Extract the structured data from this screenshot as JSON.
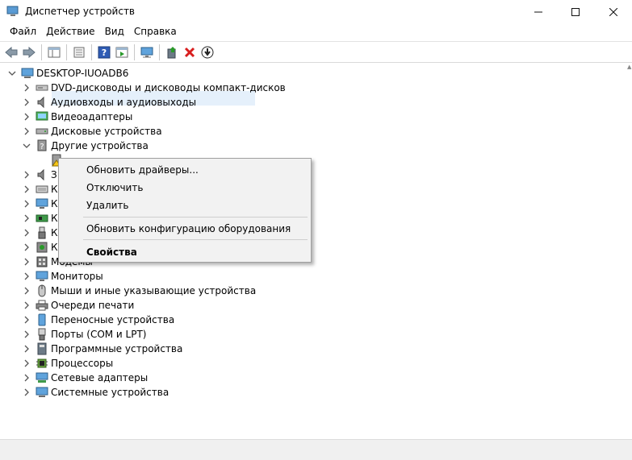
{
  "window": {
    "title": "Диспетчер устройств",
    "minimize": "–",
    "maximize": "☐",
    "close": "✕"
  },
  "menu": [
    "Файл",
    "Действие",
    "Вид",
    "Справка"
  ],
  "tree": {
    "root": "DESKTOP-IUOADB6",
    "items": [
      "DVD-дисководы и дисководы компакт-дисков",
      "Аудиовходы и аудиовыходы",
      "Видеоадаптеры",
      "Дисковые устройства",
      "Другие устройства",
      "",
      "З",
      "К",
      "К",
      "К",
      "К",
      "К",
      "Модемы",
      "Мониторы",
      "Мыши и иные указывающие устройства",
      "Очереди печати",
      "Переносные устройства",
      "Порты (COM и LPT)",
      "Программные устройства",
      "Процессоры",
      "Сетевые адаптеры",
      "Системные устройства"
    ]
  },
  "context_menu": {
    "update": "Обновить драйверы...",
    "disable": "Отключить",
    "remove": "Удалить",
    "scan": "Обновить конфигурацию оборудования",
    "properties": "Свойства"
  },
  "colors": {
    "accent": "#1979ca",
    "selection": "#e5f0fb",
    "close_red": "#d81e1e",
    "check_green": "#2a9a2a"
  }
}
